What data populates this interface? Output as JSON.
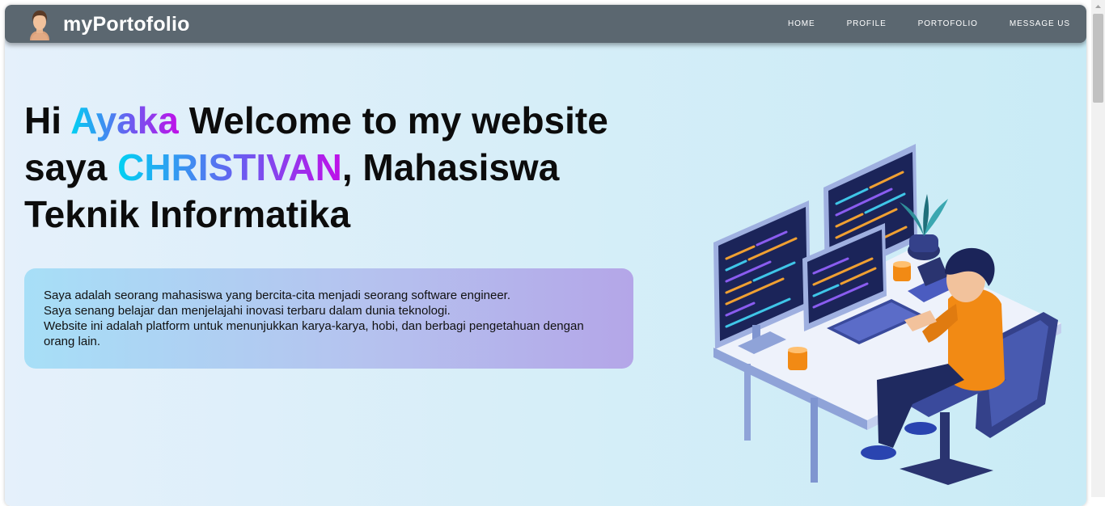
{
  "brand": {
    "name": "myPortofolio"
  },
  "nav": {
    "items": [
      {
        "label": "HOME"
      },
      {
        "label": "PROFILE"
      },
      {
        "label": "PORTOFOLIO"
      },
      {
        "label": "MESSAGE US"
      }
    ]
  },
  "hero": {
    "hi": "Hi",
    "name": "Ayaka",
    "welcome": "Welcome to my website",
    "saya": "saya",
    "highlight": "CHRISTIVAN",
    "rest_line2": ", Mahasiswa",
    "line3": "Teknik Informatika"
  },
  "about": {
    "lines": [
      "Saya adalah seorang mahasiswa yang bercita-cita menjadi seorang software engineer.",
      "Saya senang belajar dan menjelajahi inovasi terbaru dalam dunia teknologi.",
      "Website ini adalah platform untuk menunjukkan karya-karya, hobi, dan berbagi pengetahuan dengan orang lain."
    ]
  },
  "colors": {
    "navbar": "#5b6770",
    "gradient_start": "#00d2f2",
    "gradient_end": "#c010e8"
  },
  "icons": [
    "avatar-icon",
    "developer-illustration"
  ]
}
